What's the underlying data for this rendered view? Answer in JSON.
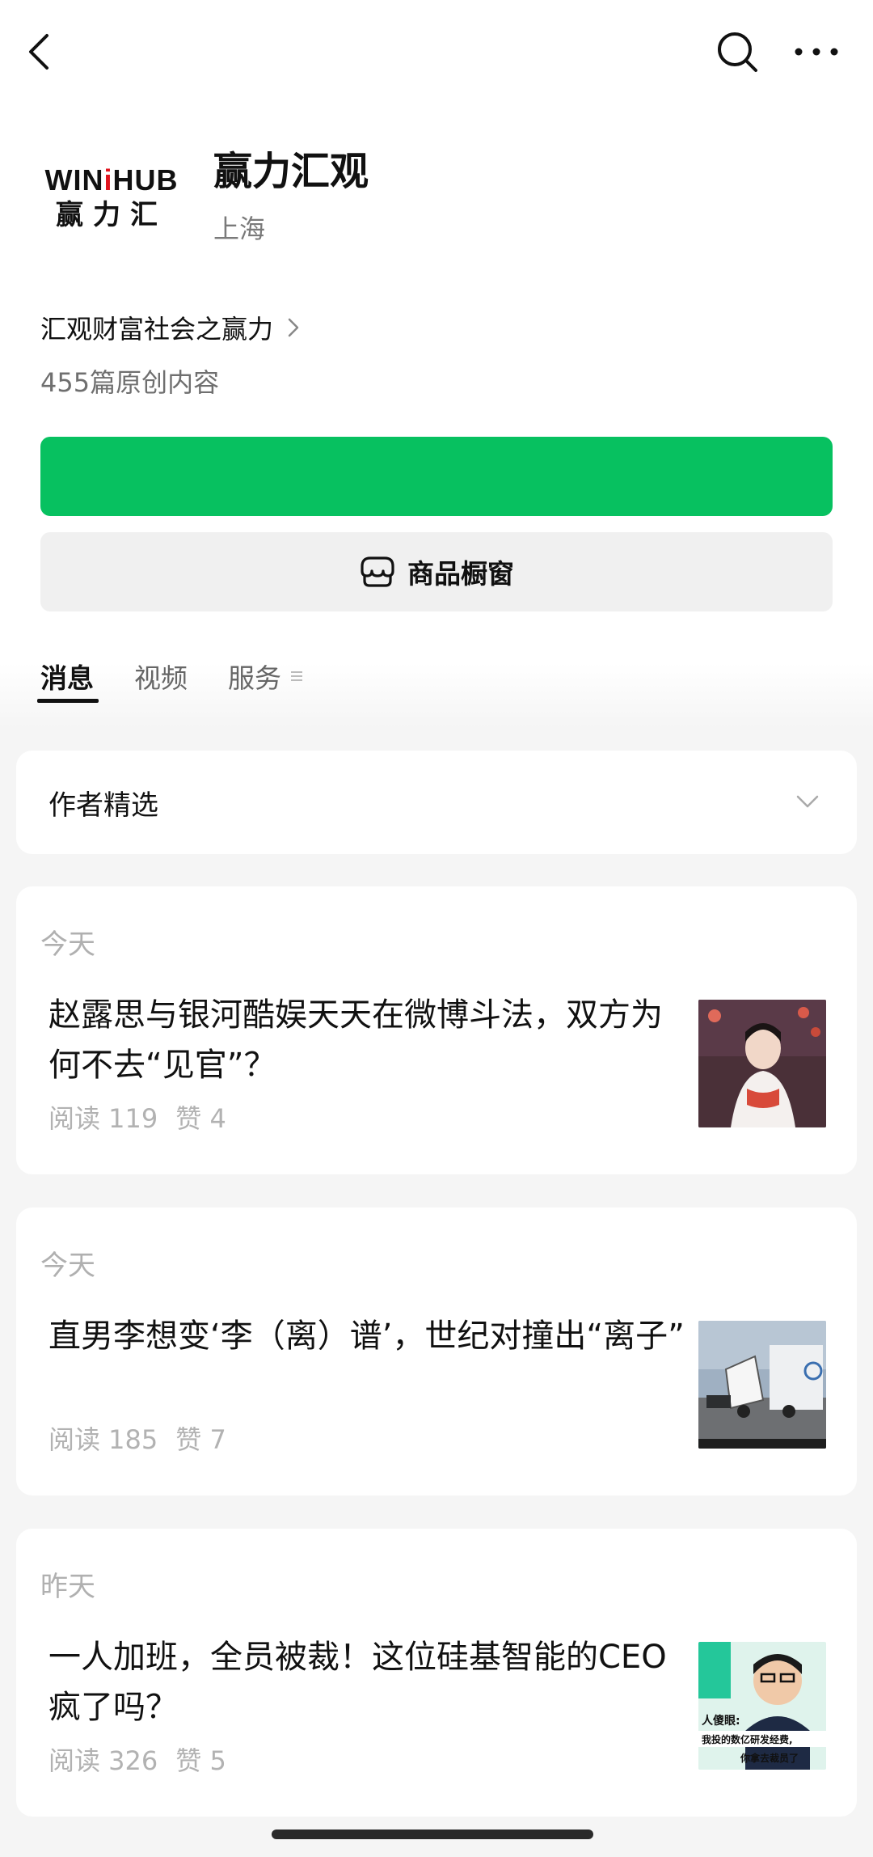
{
  "account": {
    "logo_en_pre": "WIN",
    "logo_en_i": "i",
    "logo_en_post": "HUB",
    "logo_cn": "赢力汇",
    "name": "赢力汇观",
    "location": "上海",
    "bio": "汇观财富社会之赢力",
    "content_count": "455篇原创内容"
  },
  "buttons": {
    "follow_label": "",
    "shop_label": "商品橱窗"
  },
  "tabs": [
    {
      "label": "消息",
      "active": true
    },
    {
      "label": "视频",
      "active": false
    },
    {
      "label": "服务",
      "active": false
    }
  ],
  "featured": {
    "label": "作者精选"
  },
  "articles": [
    {
      "date": "今天",
      "title": "赵露思与银河酷娱天天在微博斗法，双方为何不去“见官”？",
      "reads": "阅读 119",
      "likes": "赞 4"
    },
    {
      "date": "今天",
      "title": "直男李想变‘李（离）谱’，世纪对撞出“离子”",
      "reads": "阅读 185",
      "likes": "赞 7"
    },
    {
      "date": "昨天",
      "title": "一人加班，全员被裁！这位硅基智能的CEO疯了吗？",
      "reads": "阅读 326",
      "likes": "赞 5"
    }
  ],
  "thumb3": {
    "caption_line1": "人傻眼:",
    "caption_line2": "我投的数亿研发经费,",
    "caption_line3": "你拿去裁员了"
  },
  "colors": {
    "accent_green": "#07c160",
    "logo_red": "#e0141e"
  },
  "icons": [
    "back-arrow-icon",
    "search-icon",
    "more-dots-icon",
    "chevron-right-icon",
    "shop-icon",
    "chevron-down-icon",
    "menu-lines-icon"
  ]
}
